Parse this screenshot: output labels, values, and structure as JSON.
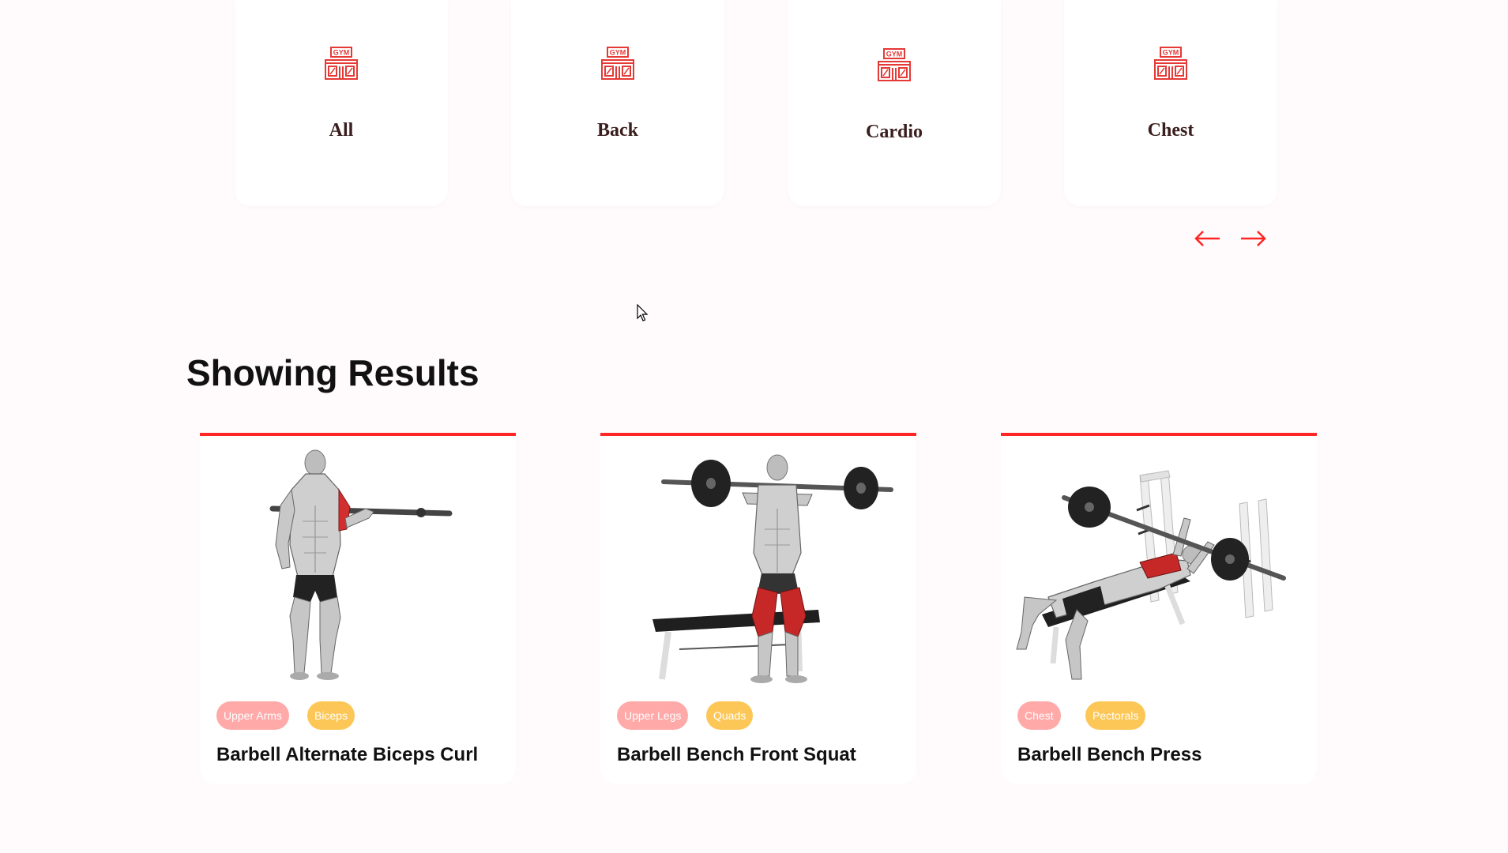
{
  "categories": [
    {
      "label": "All",
      "icon": "gym-icon"
    },
    {
      "label": "Back",
      "icon": "gym-icon"
    },
    {
      "label": "Cardio",
      "icon": "gym-icon"
    },
    {
      "label": "Chest",
      "icon": "gym-icon"
    }
  ],
  "gym_icon_text": "GYM",
  "scroll": {
    "prev_icon": "arrow-left-icon",
    "next_icon": "arrow-right-icon"
  },
  "results": {
    "title": "Showing Results",
    "exercises": [
      {
        "name": "Barbell Alternate Biceps Curl",
        "body_part": "Upper Arms",
        "target": "Biceps",
        "image": "biceps-curl-illustration"
      },
      {
        "name": "Barbell Bench Front Squat",
        "body_part": "Upper Legs",
        "target": "Quads",
        "image": "front-squat-illustration"
      },
      {
        "name": "Barbell Bench Press",
        "body_part": "Chest",
        "target": "Pectorals",
        "image": "bench-press-illustration"
      }
    ]
  },
  "colors": {
    "accent": "#ff2625",
    "bodypart_tag": "#ffa9a9",
    "target_tag": "#fcc757",
    "background": "#fffafb"
  }
}
